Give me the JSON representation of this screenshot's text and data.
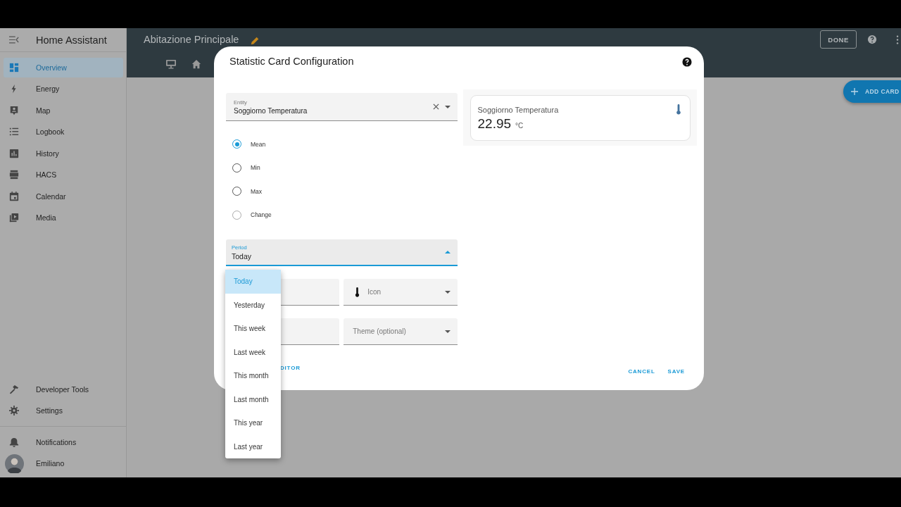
{
  "sidebar": {
    "title": "Home Assistant",
    "items": [
      {
        "label": "Overview",
        "selected": true
      },
      {
        "label": "Energy",
        "selected": false
      },
      {
        "label": "Map",
        "selected": false
      },
      {
        "label": "Logbook",
        "selected": false
      },
      {
        "label": "History",
        "selected": false
      },
      {
        "label": "HACS",
        "selected": false
      },
      {
        "label": "Calendar",
        "selected": false
      },
      {
        "label": "Media",
        "selected": false
      }
    ],
    "bottom_items": [
      {
        "label": "Developer Tools",
        "selected": false
      },
      {
        "label": "Settings",
        "selected": false
      }
    ],
    "notifications": "Notifications",
    "user": "Emiliano"
  },
  "header": {
    "title": "Abitazione Principale",
    "done_button": "DONE",
    "add_card_button": "ADD CARD"
  },
  "dialog": {
    "title": "Statistic Card Configuration",
    "entity": {
      "label": "Entity",
      "value": "Soggiorno Temperatura"
    },
    "stat_types": [
      {
        "label": "Mean",
        "selected": true
      },
      {
        "label": "Min",
        "selected": false
      },
      {
        "label": "Max",
        "selected": false
      },
      {
        "label": "Change",
        "selected": false
      }
    ],
    "period": {
      "label": "Period",
      "value": "Today",
      "expanded": true
    },
    "period_menu": [
      {
        "label": "Today",
        "selected": true
      },
      {
        "label": "Yesterday",
        "selected": false
      },
      {
        "label": "This week",
        "selected": false
      },
      {
        "label": "Last week",
        "selected": false
      },
      {
        "label": "This month",
        "selected": false
      },
      {
        "label": "Last month",
        "selected": false
      },
      {
        "label": "This year",
        "selected": false
      },
      {
        "label": "Last year",
        "selected": false
      }
    ],
    "icon_field": {
      "placeholder": "Icon"
    },
    "theme_field": {
      "placeholder": "Theme (optional)"
    },
    "preview": {
      "name": "Soggiorno Temperatura",
      "value": "22.95",
      "unit": "°C"
    },
    "code_editor_button": "DITOR",
    "cancel_button": "CANCEL",
    "save_button": "SAVE"
  }
}
